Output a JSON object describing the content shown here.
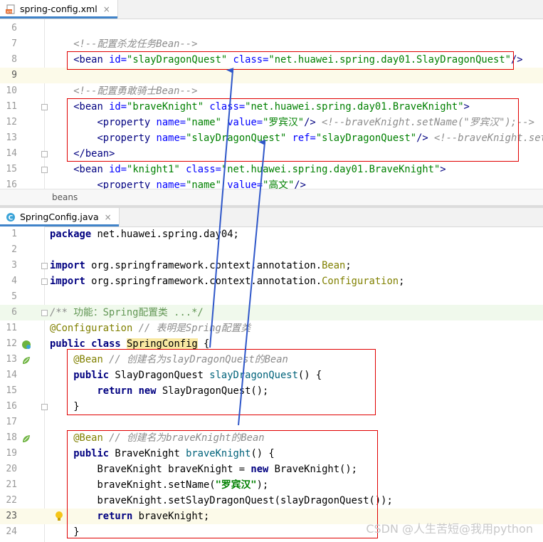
{
  "xml_editor": {
    "tab": {
      "icon": "xml-file-icon",
      "label": "spring-config.xml",
      "close": "×"
    },
    "breadcrumb": "beans",
    "lines": [
      {
        "num": "6",
        "html": ""
      },
      {
        "num": "7",
        "html": "    <span class=\"cmt\">&lt;!--配置杀龙任务Bean--&gt;</span>"
      },
      {
        "num": "8",
        "html": "    <span class=\"tag\">&lt;bean</span> <span class=\"attr\">id=</span><span class=\"val\">\"slayDragonQuest\"</span> <span class=\"attr\">class=</span><span class=\"val\">\"net.huawei.spring.day01.SlayDragonQuest\"</span><span class=\"tag\">/&gt;</span>"
      },
      {
        "num": "9",
        "html": "",
        "current": true
      },
      {
        "num": "10",
        "html": "    <span class=\"cmt\">&lt;!--配置勇敢骑士Bean--&gt;</span>"
      },
      {
        "num": "11",
        "html": "    <span class=\"tag\">&lt;bean</span> <span class=\"attr\">id=</span><span class=\"val\">\"braveKnight\"</span> <span class=\"attr\">class=</span><span class=\"val\">\"net.huawei.spring.day01.BraveKnight\"</span><span class=\"tag\">&gt;</span>",
        "fold": true
      },
      {
        "num": "12",
        "html": "        <span class=\"tag\">&lt;property</span> <span class=\"attr\">name=</span><span class=\"val\">\"name\"</span> <span class=\"attr\">value=</span><span class=\"val\">\"罗宾汉\"</span><span class=\"tag\">/&gt;</span> <span class=\"cmt\">&lt;!--braveKnight.setName(\"罗宾汉\");--&gt;</span>"
      },
      {
        "num": "13",
        "html": "        <span class=\"tag\">&lt;property</span> <span class=\"attr\">name=</span><span class=\"val\">\"slayDragonQuest\"</span> <span class=\"attr\">ref=</span><span class=\"val\">\"slayDragonQuest\"</span><span class=\"tag\">/&gt;</span> <span class=\"cmt\">&lt;!--braveKnight.setSla</span>"
      },
      {
        "num": "14",
        "html": "    <span class=\"tag\">&lt;/bean&gt;</span>",
        "fold": true
      },
      {
        "num": "15",
        "html": "    <span class=\"tag\">&lt;bean</span> <span class=\"attr\">id=</span><span class=\"val\">\"knight1\"</span> <span class=\"attr\">class=</span><span class=\"val\">\"net.huawei.spring.day01.BraveKnight\"</span><span class=\"tag\">&gt;</span>",
        "fold": true
      },
      {
        "num": "16",
        "html": "        <span class=\"tag\">&lt;property</span> <span class=\"attr\">name=</span><span class=\"val\">\"name\"</span> <span class=\"attr\">value=</span><span class=\"val\">\"高文\"</span><span class=\"tag\">/&gt;</span>"
      }
    ]
  },
  "java_editor": {
    "tab": {
      "icon": "java-class-icon",
      "label": "SpringConfig.java",
      "close": "×"
    },
    "lines": [
      {
        "num": "1",
        "html": "<span class=\"kw\">package</span> net.huawei.spring.day04;"
      },
      {
        "num": "2",
        "html": ""
      },
      {
        "num": "3",
        "html": "<span class=\"kw\">import</span> org.springframework.context.annotation.<span class=\"ann\">Bean</span>;",
        "fold": true
      },
      {
        "num": "4",
        "html": "<span class=\"kw\">import</span> org.springframework.context.annotation.<span class=\"ann\">Configuration</span>;",
        "fold": true
      },
      {
        "num": "5",
        "html": ""
      },
      {
        "num": "6",
        "html": "<span class=\"cmt\">/** </span><span style=\"color:#629755\">功能：Spring配置类 ...*/</span>",
        "fold": true,
        "doc": true
      },
      {
        "num": "11",
        "html": "<span class=\"ann\">@Configuration</span> <span class=\"cmt\">// 表明是Spring配置类</span>"
      },
      {
        "num": "12",
        "html": "<span class=\"kw\">public class</span> <span class=\"hl\">SpringConfig</span> {",
        "gicon": "spring-config-icon"
      },
      {
        "num": "13",
        "html": "    <span class=\"ann\">@Bean</span> <span class=\"cmt\">// 创建名为slayDragonQuest的Bean</span>",
        "gicon": "spring-bean-icon"
      },
      {
        "num": "14",
        "html": "    <span class=\"kw\">public</span> SlayDragonQuest <span class=\"fn\">slayDragonQuest</span>() {"
      },
      {
        "num": "15",
        "html": "        <span class=\"kw\">return new</span> SlayDragonQuest();"
      },
      {
        "num": "16",
        "html": "    }",
        "fold": true
      },
      {
        "num": "17",
        "html": ""
      },
      {
        "num": "18",
        "html": "    <span class=\"ann\">@Bean</span> <span class=\"cmt\">// 创建名为braveKnight的Bean</span>",
        "gicon": "spring-bean-icon"
      },
      {
        "num": "19",
        "html": "    <span class=\"kw\">public</span> BraveKnight <span class=\"fn\">braveKnight</span>() {"
      },
      {
        "num": "20",
        "html": "        BraveKnight braveKnight = <span class=\"kw\">new</span> BraveKnight();"
      },
      {
        "num": "21",
        "html": "        braveKnight.setName(<span class=\"str\">\"罗宾汉\"</span>);"
      },
      {
        "num": "22",
        "html": "        braveKnight.setSlayDragonQuest(slayDragonQuest());"
      },
      {
        "num": "23",
        "html": "        <span class=\"kw\">return</span> braveKnight;",
        "current": true,
        "bulb": true
      },
      {
        "num": "24",
        "html": "    }"
      }
    ]
  },
  "watermark": "CSDN @人生苦短@我用python",
  "colors": {
    "highlight_box": "#e00000",
    "arrow": "#2f57c9",
    "accent_tab": "#4083c9"
  }
}
